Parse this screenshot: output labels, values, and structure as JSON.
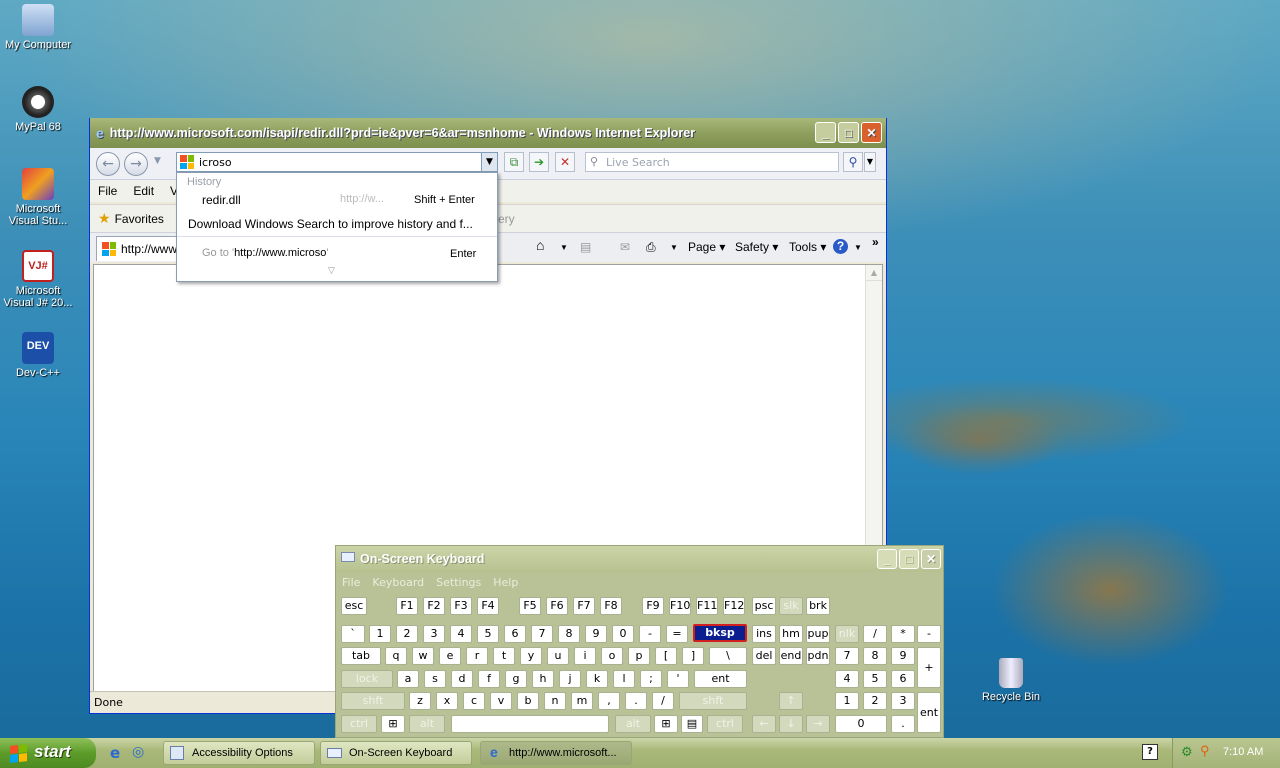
{
  "desktop": {
    "icons": [
      {
        "label": "My Computer"
      },
      {
        "label": "MyPal 68"
      },
      {
        "label": "Microsoft Visual Stu..."
      },
      {
        "label": "Microsoft Visual J# 20..."
      },
      {
        "label": "Dev-C++"
      },
      {
        "label": "Recycle Bin"
      }
    ]
  },
  "ie": {
    "title": "http://www.microsoft.com/isapi/redir.dll?prd=ie&pver=6&ar=msnhome - Windows Internet Explorer",
    "address_value": "icroso",
    "search_placeholder": "Live Search",
    "menu": [
      "File",
      "Edit",
      "Vi"
    ],
    "favorites_label": "Favorites",
    "gallery_partial": "ery",
    "tab_label": "http://www",
    "commands": [
      "Page",
      "Safety",
      "Tools"
    ],
    "status": "Done",
    "autocomplete": {
      "header": "History",
      "item1_label": "redir.dll",
      "item1_url": "http://w...",
      "item1_shortcut": "Shift + Enter",
      "download_text": "Download Windows Search to improve history and f...",
      "goto_prefix": "Go to '",
      "goto_url": "http://www.microso",
      "goto_suffix": "'",
      "goto_shortcut": "Enter"
    }
  },
  "osk": {
    "title": "On-Screen Keyboard",
    "menu": [
      "File",
      "Keyboard",
      "Settings",
      "Help"
    ]
  },
  "taskbar": {
    "start_label": "start",
    "buttons": [
      "Accessibility Options",
      "On-Screen Keyboard",
      "http://www.microsoft..."
    ],
    "clock": "7:10 AM"
  }
}
